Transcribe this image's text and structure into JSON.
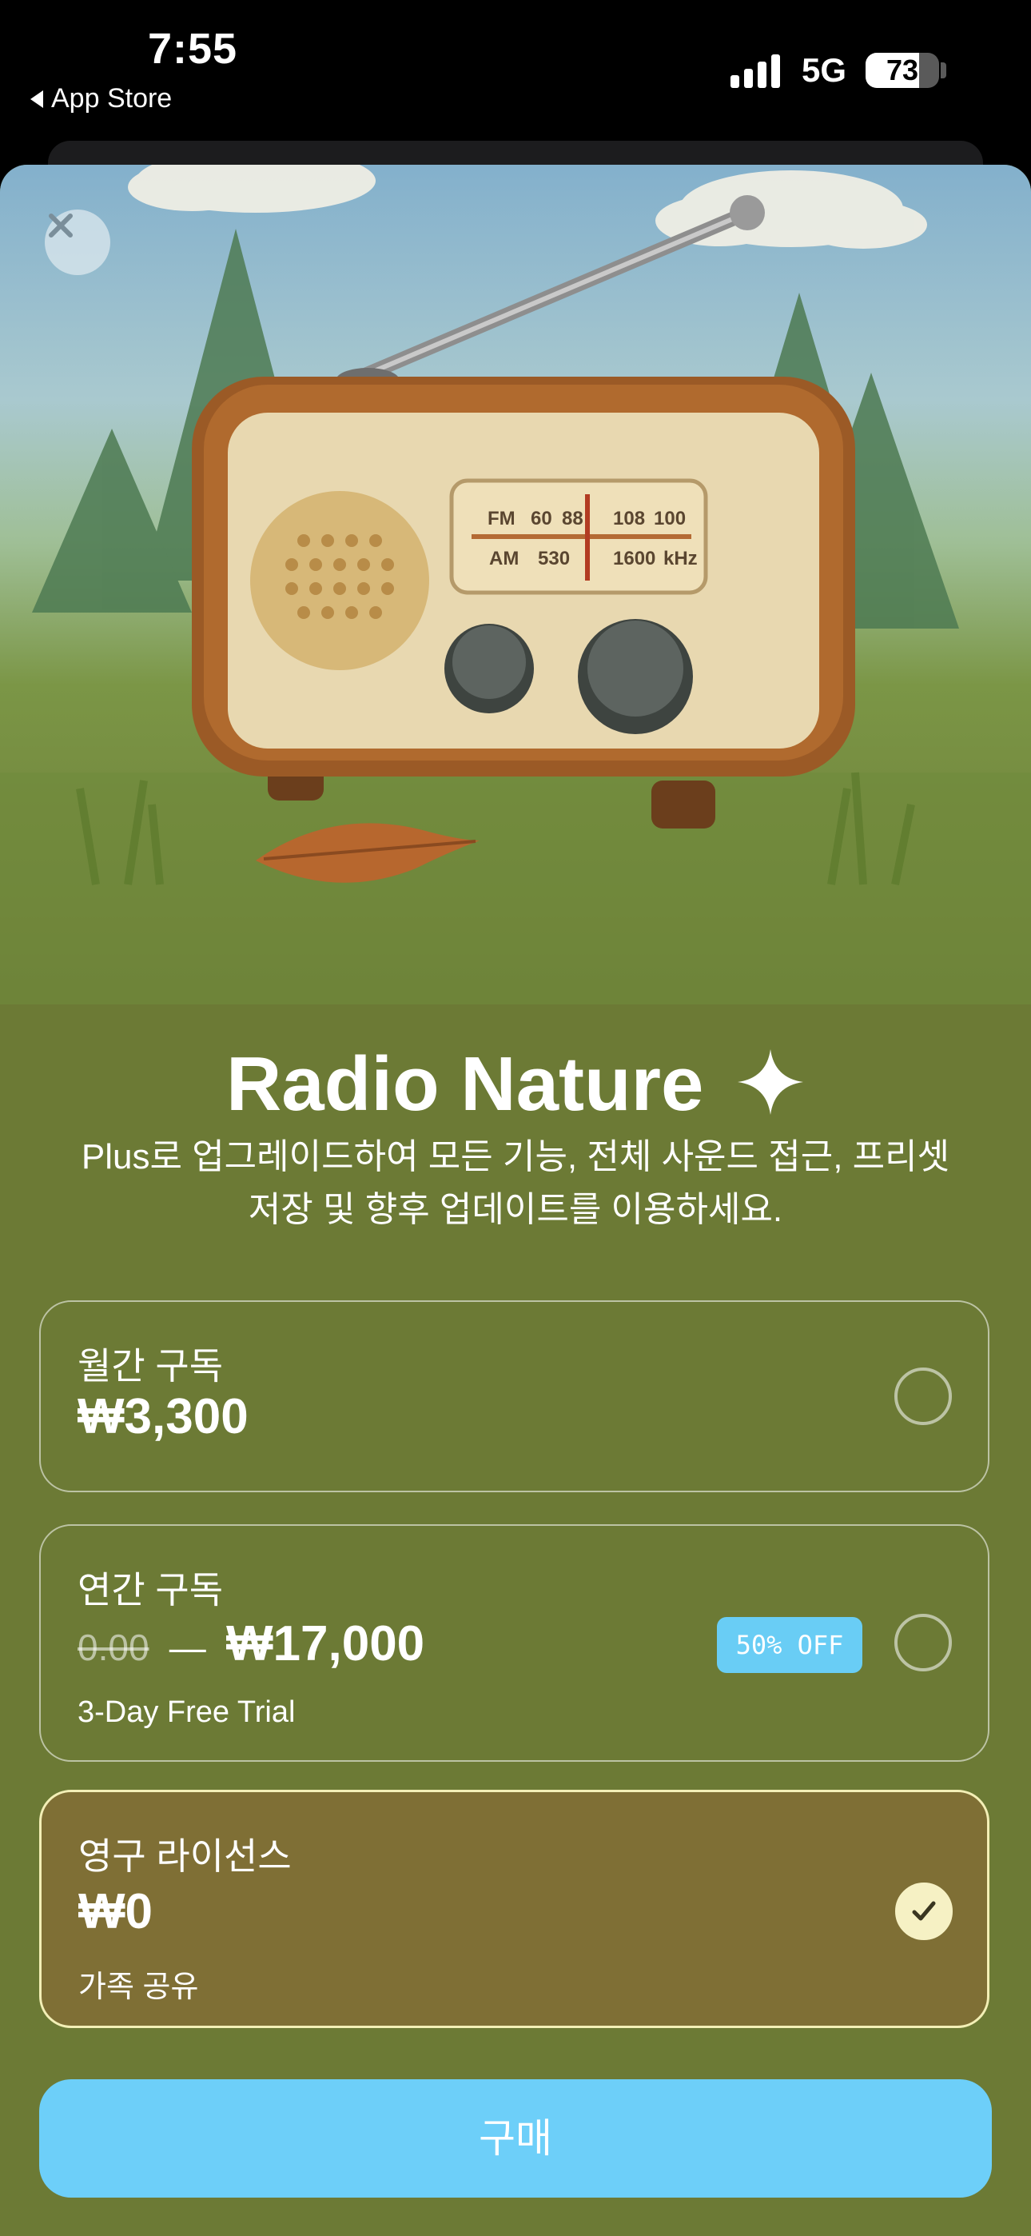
{
  "status_bar": {
    "time": "7:55",
    "back_label": "App Store",
    "network": "5G",
    "battery_level": 73,
    "battery_text": "73"
  },
  "hero": {
    "radio_dial": {
      "fm_label": "FM",
      "fm_marks": [
        "60",
        "88",
        "108",
        "100"
      ],
      "am_label": "AM",
      "am_marks": [
        "530",
        "1600",
        "kHz"
      ]
    }
  },
  "header": {
    "title": "Radio Nature",
    "subtitle_line1": "Plus로 업그레이드하여 모든 기능, 전체 사운드 접근, 프리셋",
    "subtitle_line2": "저장 및 향후 업데이트를 이용하세요."
  },
  "plans": [
    {
      "name": "월간 구독",
      "price": "₩3,300",
      "selected": false
    },
    {
      "name": "연간 구독",
      "original_price": "0.00",
      "dash": "—",
      "price": "₩17,000",
      "note": "3-Day Free Trial",
      "badge": "50% OFF",
      "selected": false
    },
    {
      "name": "영구 라이선스",
      "price": "₩0",
      "note": "가족 공유",
      "selected": true
    }
  ],
  "buy_button": {
    "label": "구매"
  },
  "colors": {
    "sheet_background": "#6c7a35",
    "selected_plan_background": "#7f6f35",
    "accent_button": "#6dcff9",
    "badge": "#69cdf5"
  }
}
